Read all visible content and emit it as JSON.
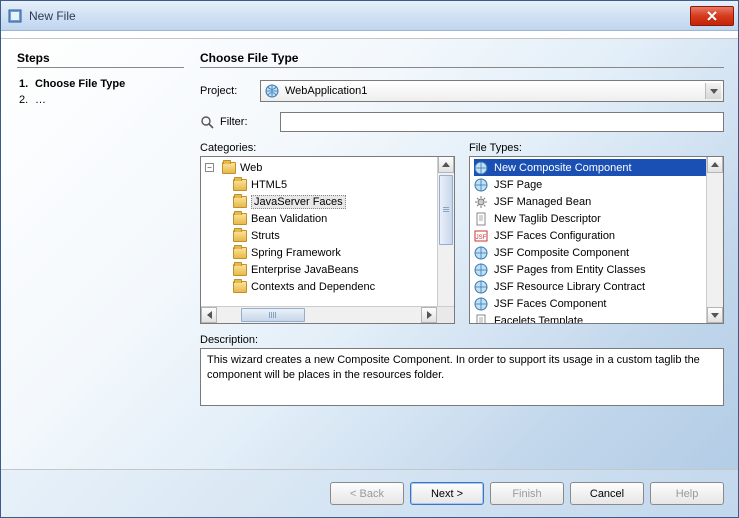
{
  "window": {
    "title": "New File"
  },
  "steps": {
    "heading": "Steps",
    "items": [
      {
        "num": "1.",
        "label": "Choose File Type",
        "active": true
      },
      {
        "num": "2.",
        "label": "…",
        "active": false
      }
    ]
  },
  "main": {
    "heading": "Choose File Type",
    "project_label": "Project:",
    "project_value": "WebApplication1",
    "filter_label": "Filter:",
    "filter_value": "",
    "categories_label": "Categories:",
    "filetypes_label": "File Types:",
    "description_label": "Description:",
    "description_text": "This wizard creates a new Composite Component. In order to support its usage in a custom taglib the component will be places in the resources folder."
  },
  "categories": [
    {
      "label": "Web",
      "indent": 1
    },
    {
      "label": "HTML5",
      "indent": 1
    },
    {
      "label": "JavaServer Faces",
      "indent": 1,
      "selected": true
    },
    {
      "label": "Bean Validation",
      "indent": 1
    },
    {
      "label": "Struts",
      "indent": 1
    },
    {
      "label": "Spring Framework",
      "indent": 1
    },
    {
      "label": "Enterprise JavaBeans",
      "indent": 1
    },
    {
      "label": "Contexts and Dependenc",
      "indent": 1
    }
  ],
  "fileTypes": [
    {
      "label": "New Composite Component",
      "icon": "globe",
      "selected": true
    },
    {
      "label": "JSF Page",
      "icon": "globe"
    },
    {
      "label": "JSF Managed Bean",
      "icon": "gear"
    },
    {
      "label": "New Taglib Descriptor",
      "icon": "doc"
    },
    {
      "label": "JSF Faces Configuration",
      "icon": "jsf"
    },
    {
      "label": "JSF Composite Component",
      "icon": "globe"
    },
    {
      "label": "JSF Pages from Entity Classes",
      "icon": "globe"
    },
    {
      "label": "JSF Resource Library Contract",
      "icon": "globe"
    },
    {
      "label": "JSF Faces Component",
      "icon": "globe"
    },
    {
      "label": "Facelets Template",
      "icon": "doc"
    }
  ],
  "buttons": {
    "back": "< Back",
    "next": "Next >",
    "finish": "Finish",
    "cancel": "Cancel",
    "help": "Help"
  },
  "icons": {
    "close": "close",
    "globe": "globe",
    "magnifier": "magnifier"
  }
}
